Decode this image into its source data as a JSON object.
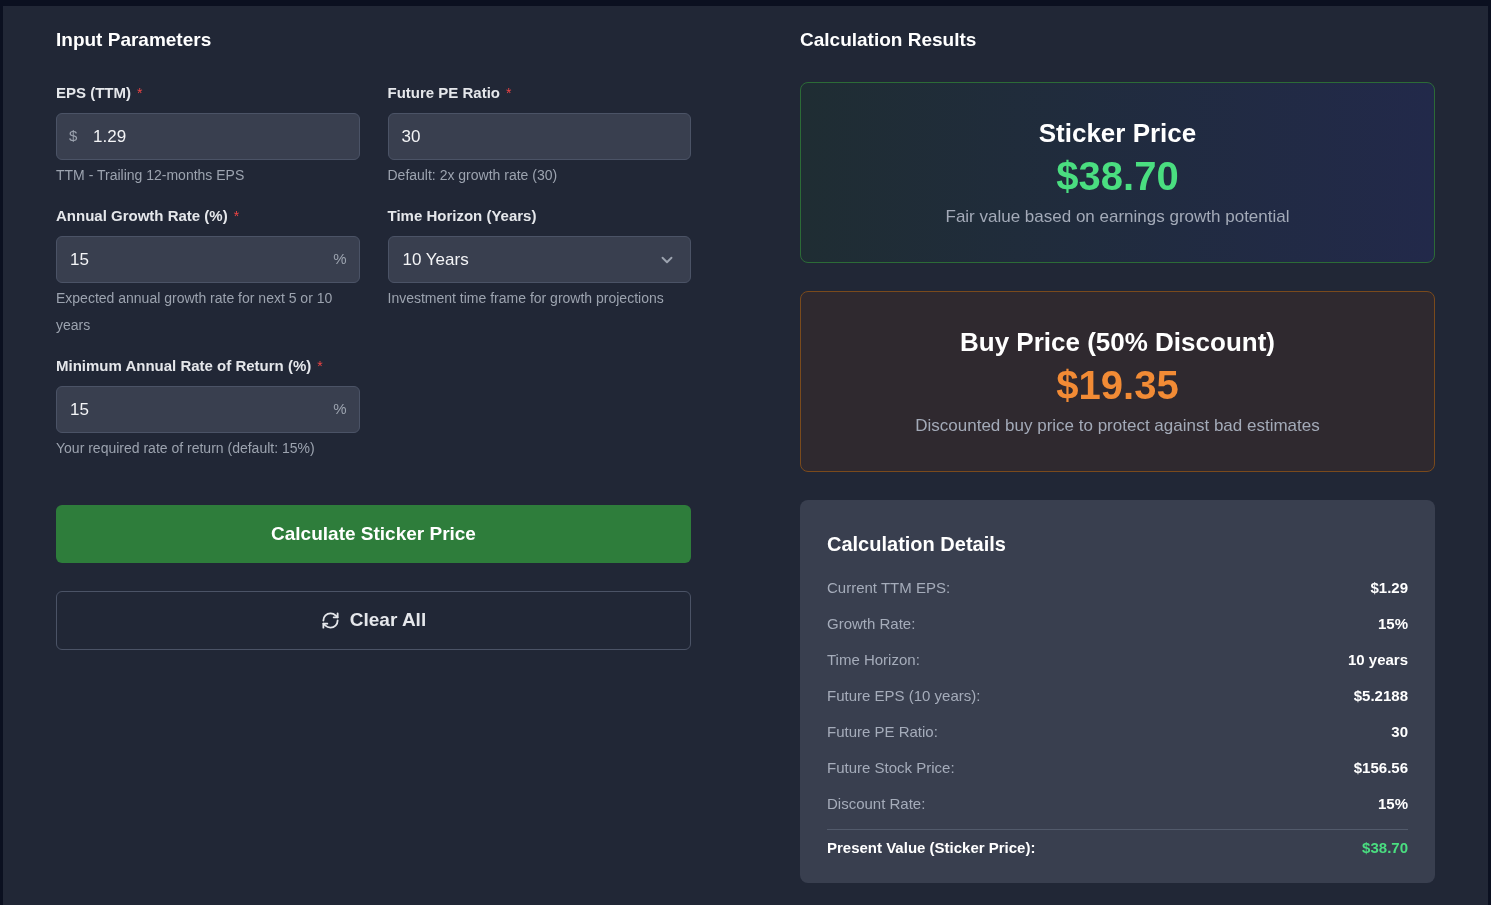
{
  "input_panel": {
    "title": "Input Parameters",
    "fields": [
      {
        "kind": "input",
        "label": "EPS (TTM)",
        "required_mark": "*",
        "prefix": "$",
        "value": "1.29",
        "hint": "TTM - Trailing 12-months EPS"
      },
      {
        "kind": "input",
        "label": "Future PE Ratio",
        "required_mark": "*",
        "value": "30",
        "hint": "Default: 2x growth rate (30)"
      },
      {
        "kind": "input",
        "label": "Annual Growth Rate (%)",
        "required_mark": "*",
        "suffix": "%",
        "value": "15",
        "hint": "Expected annual growth rate for next 5 or 10 years"
      },
      {
        "kind": "select",
        "label": "Time Horizon (Years)",
        "value": "10 Years",
        "hint": "Investment time frame for growth projections"
      },
      {
        "kind": "input",
        "label": "Minimum Annual Rate of Return (%)",
        "required_mark": "*",
        "suffix": "%",
        "value": "15",
        "hint": "Your required rate of return (default: 15%)"
      }
    ],
    "buttons": [
      {
        "kind": "primary",
        "label": "Calculate Sticker Price"
      },
      {
        "kind": "outline",
        "label": "Clear All"
      }
    ]
  },
  "results_panel": {
    "title": "Calculation Results",
    "cards": [
      {
        "kind": "sticker",
        "title": "Sticker Price",
        "price": "$38.70",
        "caption": "Fair value based on earnings growth potential"
      },
      {
        "kind": "buy",
        "title": "Buy Price (50% Discount)",
        "price": "$19.35",
        "caption": "Discounted buy price to protect against bad estimates"
      }
    ],
    "details": {
      "title": "Calculation Details",
      "rows": [
        {
          "label": "Current TTM EPS:",
          "value": "$1.29"
        },
        {
          "label": "Growth Rate:",
          "value": "15%"
        },
        {
          "label": "Time Horizon:",
          "value": "10 years"
        },
        {
          "label": "Future EPS (10 years):",
          "value": "$5.2188"
        },
        {
          "label": "Future PE Ratio:",
          "value": "30"
        },
        {
          "label": "Future Stock Price:",
          "value": "$156.56"
        },
        {
          "label": "Discount Rate:",
          "value": "15%"
        }
      ],
      "total": {
        "label": "Present Value (Sticker Price):",
        "value": "$38.70"
      }
    }
  }
}
